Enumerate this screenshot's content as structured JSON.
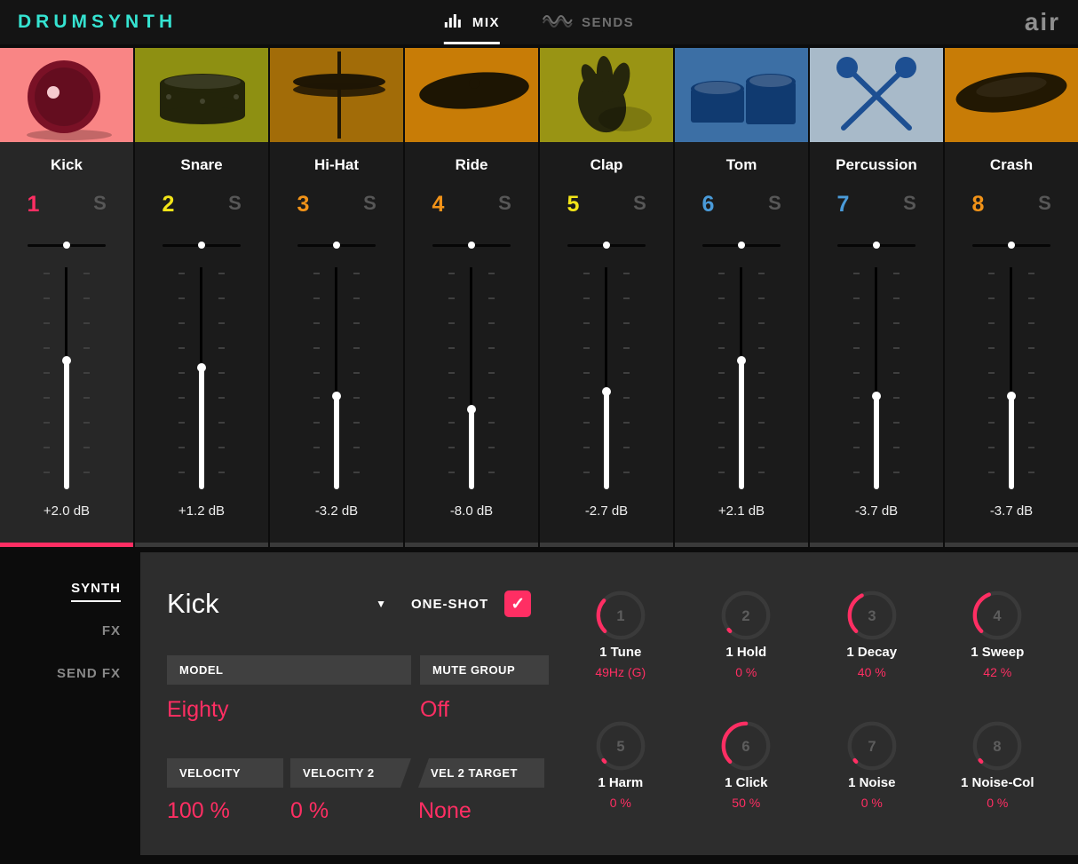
{
  "colors": {
    "accent": "#ff2e63",
    "logo": "#35e3d1"
  },
  "icons": {
    "checkmark": "✓",
    "caret_down": "▼"
  },
  "header": {
    "logo": "DRUMSYNTH",
    "brand": "air",
    "tabs": [
      {
        "label": "MIX",
        "active": true
      },
      {
        "label": "SENDS",
        "active": false
      }
    ]
  },
  "channels": [
    {
      "name": "Kick",
      "number": "1",
      "solo": "S",
      "db": "+2.0 dB",
      "number_color": "#ff2e63",
      "selected": true,
      "fader": 0.58,
      "art": "kick",
      "art_bg": "#f98585",
      "art_fg": "#7a1126"
    },
    {
      "name": "Snare",
      "number": "2",
      "solo": "S",
      "db": "+1.2 dB",
      "number_color": "#f2e418",
      "selected": false,
      "fader": 0.55,
      "art": "snare",
      "art_bg": "#8e9012",
      "art_fg": "#23240a"
    },
    {
      "name": "Hi-Hat",
      "number": "3",
      "solo": "S",
      "db": "-3.2 dB",
      "number_color": "#f29318",
      "selected": false,
      "fader": 0.42,
      "art": "hihat",
      "art_bg": "#a26c08",
      "art_fg": "#1f1604"
    },
    {
      "name": "Ride",
      "number": "4",
      "solo": "S",
      "db": "-8.0 dB",
      "number_color": "#f29318",
      "selected": false,
      "fader": 0.36,
      "art": "ride",
      "art_bg": "#c87c06",
      "art_fg": "#1d1503"
    },
    {
      "name": "Clap",
      "number": "5",
      "solo": "S",
      "db": "-2.7 dB",
      "number_color": "#f2e418",
      "selected": false,
      "fader": 0.44,
      "art": "clap",
      "art_bg": "#999414",
      "art_fg": "#26260c"
    },
    {
      "name": "Tom",
      "number": "6",
      "solo": "S",
      "db": "+2.1 dB",
      "number_color": "#4a9bd9",
      "selected": false,
      "fader": 0.58,
      "art": "tom",
      "art_bg": "#3c6fa5",
      "art_fg": "#103a70"
    },
    {
      "name": "Percussion",
      "number": "7",
      "solo": "S",
      "db": "-3.7 dB",
      "number_color": "#4a9bd9",
      "selected": false,
      "fader": 0.42,
      "art": "perc",
      "art_bg": "#a8bac9",
      "art_fg": "#1d4f92"
    },
    {
      "name": "Crash",
      "number": "8",
      "solo": "S",
      "db": "-3.7 dB",
      "number_color": "#f29318",
      "selected": false,
      "fader": 0.42,
      "art": "crash",
      "art_bg": "#c87c06",
      "art_fg": "#221803"
    }
  ],
  "sidebar": {
    "items": [
      {
        "label": "SYNTH",
        "active": true
      },
      {
        "label": "FX",
        "active": false
      },
      {
        "label": "SEND FX",
        "active": false
      }
    ]
  },
  "editor": {
    "instrument": "Kick",
    "one_shot": {
      "label": "ONE-SHOT",
      "checked": true
    },
    "fields": {
      "model": {
        "label": "MODEL",
        "value": "Eighty"
      },
      "mute_group": {
        "label": "MUTE GROUP",
        "value": "Off"
      },
      "velocity": {
        "label": "VELOCITY",
        "value": "100 %"
      },
      "velocity2": {
        "label": "VELOCITY 2",
        "value": "0 %"
      },
      "vel2_target": {
        "label": "VEL 2 TARGET",
        "value": "None"
      }
    },
    "knobs": [
      {
        "num": "1",
        "label": "1 Tune",
        "value": "49Hz (G)",
        "amount": 0.32
      },
      {
        "num": "2",
        "label": "1 Hold",
        "value": "0 %",
        "amount": 0.02
      },
      {
        "num": "3",
        "label": "1 Decay",
        "value": "40 %",
        "amount": 0.4
      },
      {
        "num": "4",
        "label": "1 Sweep",
        "value": "42 %",
        "amount": 0.42
      },
      {
        "num": "5",
        "label": "1 Harm",
        "value": "0 %",
        "amount": 0.02
      },
      {
        "num": "6",
        "label": "1 Click",
        "value": "50 %",
        "amount": 0.5
      },
      {
        "num": "7",
        "label": "1 Noise",
        "value": "0 %",
        "amount": 0.02
      },
      {
        "num": "8",
        "label": "1 Noise-Col",
        "value": "0 %",
        "amount": 0.02
      }
    ]
  }
}
